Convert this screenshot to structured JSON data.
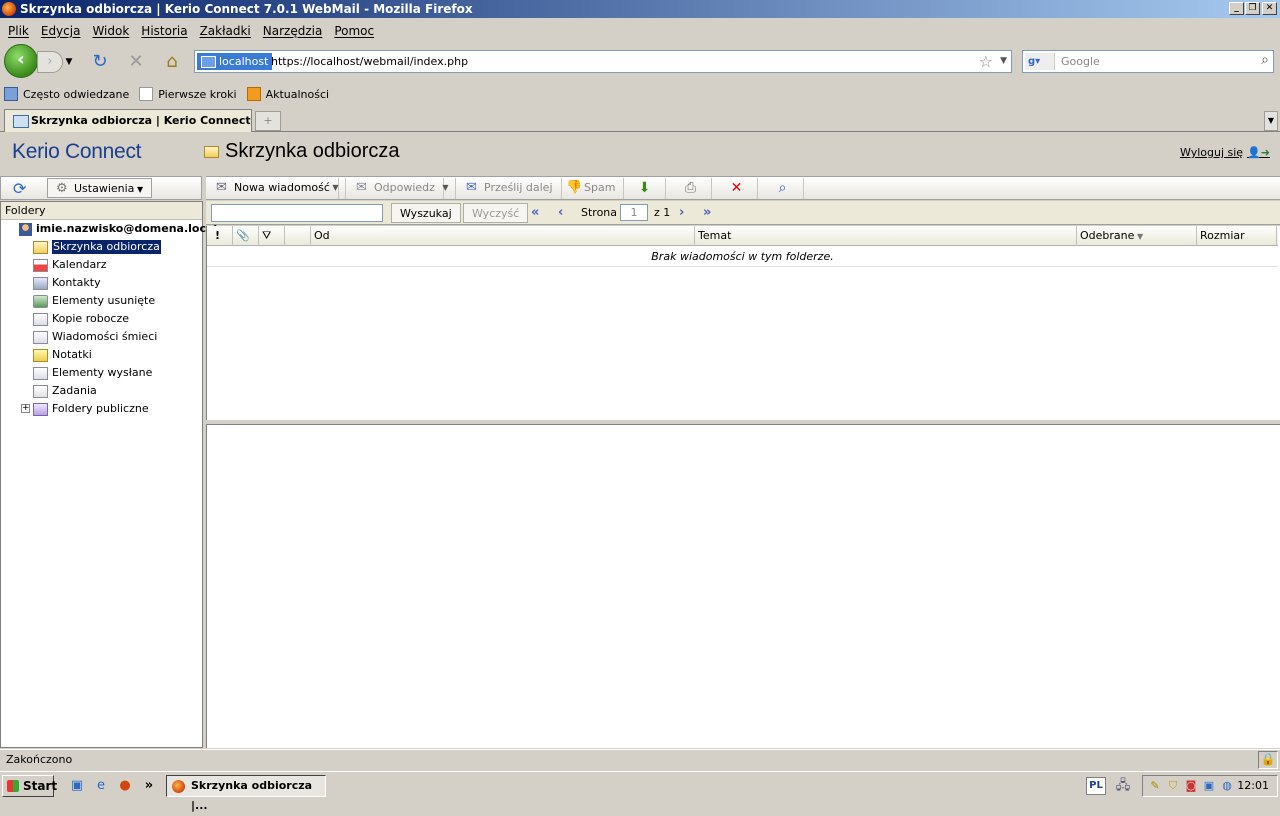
{
  "window": {
    "title": "Skrzynka odbiorcza | Kerio Connect 7.0.1 WebMail - Mozilla Firefox"
  },
  "menu": [
    "Plik",
    "Edycja",
    "Widok",
    "Historia",
    "Zakładki",
    "Narzędzia",
    "Pomoc"
  ],
  "nav": {
    "site_label": "localhost",
    "url": "https://localhost/webmail/index.php",
    "search_placeholder": "Google"
  },
  "bookmarks": [
    "Często odwiedzane",
    "Pierwsze kroki",
    "Aktualności"
  ],
  "tabs": [
    {
      "label": "Skrzynka odbiorcza | Kerio Connect ..."
    }
  ],
  "app": {
    "brand": "Kerio Connect",
    "folder_title": "Skrzynka odbiorcza",
    "logout": "Wyloguj się",
    "settings_label": "Ustawienia"
  },
  "folders": {
    "header": "Foldery",
    "account": "imie.nazwisko@domena.local",
    "items": [
      {
        "label": "Skrzynka odbiorcza",
        "icon": "inbox-icon",
        "selected": true
      },
      {
        "label": "Kalendarz",
        "icon": "calendar-icon"
      },
      {
        "label": "Kontakty",
        "icon": "contacts-icon"
      },
      {
        "label": "Elementy usunięte",
        "icon": "trash-icon"
      },
      {
        "label": "Kopie robocze",
        "icon": "drafts-icon"
      },
      {
        "label": "Wiadomości śmieci",
        "icon": "junk-icon"
      },
      {
        "label": "Notatki",
        "icon": "notes-icon"
      },
      {
        "label": "Elementy wysłane",
        "icon": "sent-icon"
      },
      {
        "label": "Zadania",
        "icon": "tasks-icon"
      },
      {
        "label": "Foldery publiczne",
        "icon": "public-folders-icon"
      }
    ]
  },
  "toolbar": {
    "new_message": "Nowa wiadomość",
    "reply": "Odpowiedz",
    "forward": "Prześlij dalej",
    "spam": "Spam"
  },
  "search": {
    "search_button": "Wyszukaj",
    "clear_button": "Wyczyść",
    "page_label": "Strona",
    "page_value": "1",
    "page_of": "z 1"
  },
  "grid": {
    "columns": [
      "!",
      "",
      "",
      "",
      "Od",
      "Temat",
      "Odebrane",
      "Rozmiar"
    ],
    "empty_message": "Brak wiadomości w tym folderze."
  },
  "status": {
    "text": "Zakończono"
  },
  "taskbar": {
    "start": "Start",
    "task_item": "Skrzynka odbiorcza |...",
    "language": "PL",
    "clock": "12:01"
  }
}
